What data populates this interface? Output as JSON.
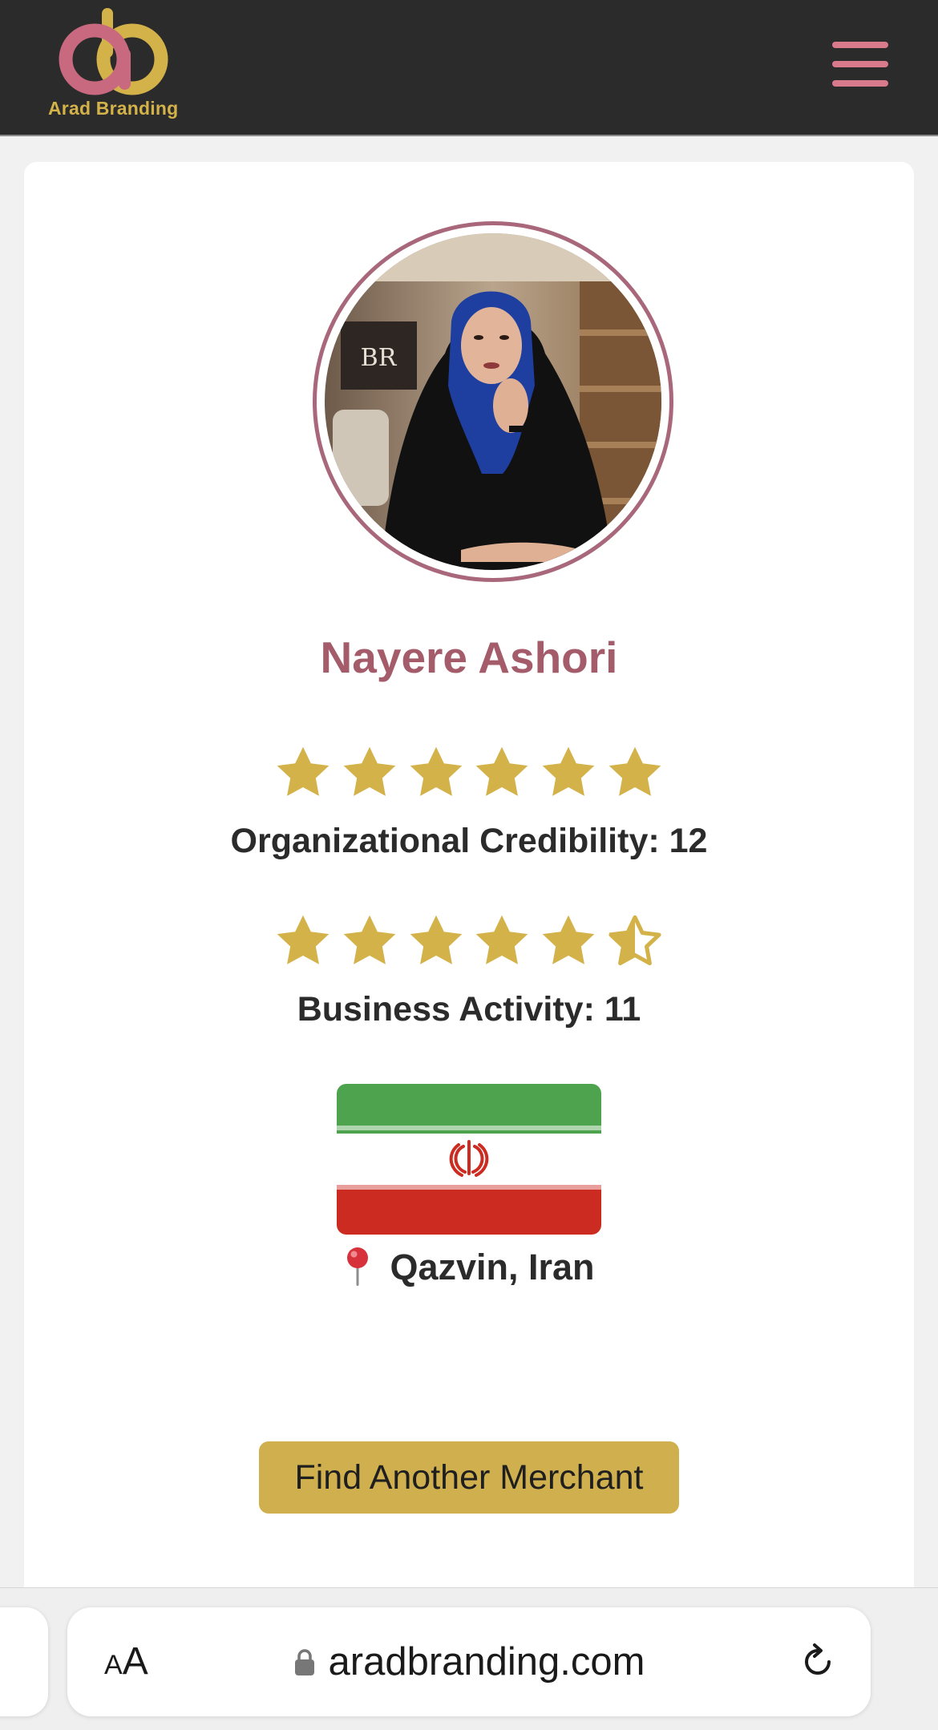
{
  "header": {
    "logo_text": "Arad Branding",
    "menu_icon": "hamburger-menu-icon"
  },
  "profile": {
    "name": "Nayere Ashori",
    "ratings": [
      {
        "label": "Organizational Credibility: 12",
        "stars": 6,
        "max_stars": 6
      },
      {
        "label": "Business Activity: 11",
        "stars": 5.5,
        "max_stars": 6
      }
    ],
    "location": "Qazvin, Iran",
    "country_flag": "iran-flag-icon"
  },
  "actions": {
    "find_another": "Find Another Merchant"
  },
  "browser": {
    "text_size_small": "A",
    "text_size_large": "A",
    "url": "aradbranding.com"
  },
  "colors": {
    "header_bg": "#2b2b2b",
    "brand_pink": "#c9697f",
    "brand_gold": "#d4b24a",
    "name_color": "#a45c6b",
    "star_gold": "#d4b24a",
    "button_gold": "#d0b04e"
  }
}
